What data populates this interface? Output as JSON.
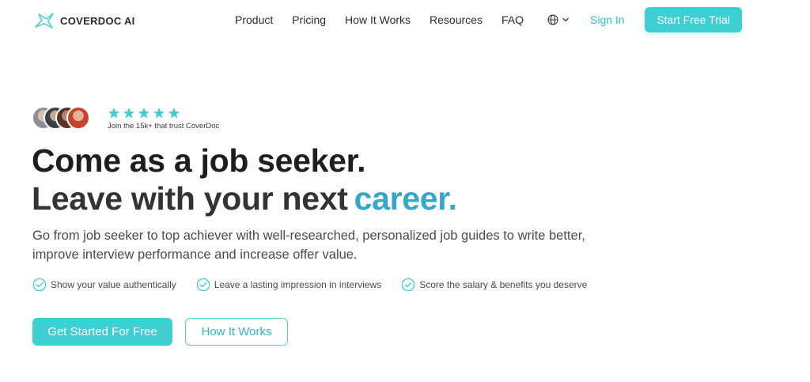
{
  "nav": {
    "brand": "COVERDOC AI",
    "menu": [
      {
        "label": "Product",
        "name": "nav-product"
      },
      {
        "label": "Pricing",
        "name": "nav-pricing"
      },
      {
        "label": "How It Works",
        "name": "nav-how-it-works"
      },
      {
        "label": "Resources",
        "name": "nav-resources"
      },
      {
        "label": "FAQ",
        "name": "nav-faq"
      }
    ],
    "language_icon": "globe-icon",
    "sign_in": "Sign In",
    "trial_button": "Start Free Trial"
  },
  "hero": {
    "stars": 5,
    "trust_text": "Join the 15k+ that trust CoverDoc",
    "headline_line1": "Come as a job seeker.",
    "headline_line2": "Leave with your next",
    "headline_accent": "career.",
    "subtitle": "Go from job seeker to top achiever with well-researched, personalized job guides to write better, improve interview performance and increase offer value.",
    "features": [
      "Show your value authentically",
      "Leave a lasting impression in interviews",
      "Score the salary & benefits you deserve"
    ],
    "cta_primary": "Get Started For Free",
    "cta_secondary": "How It Works"
  },
  "colors": {
    "accent": "#3fcfd3",
    "headline_accent": "#35a7c9",
    "star": "#3fcfd3"
  }
}
